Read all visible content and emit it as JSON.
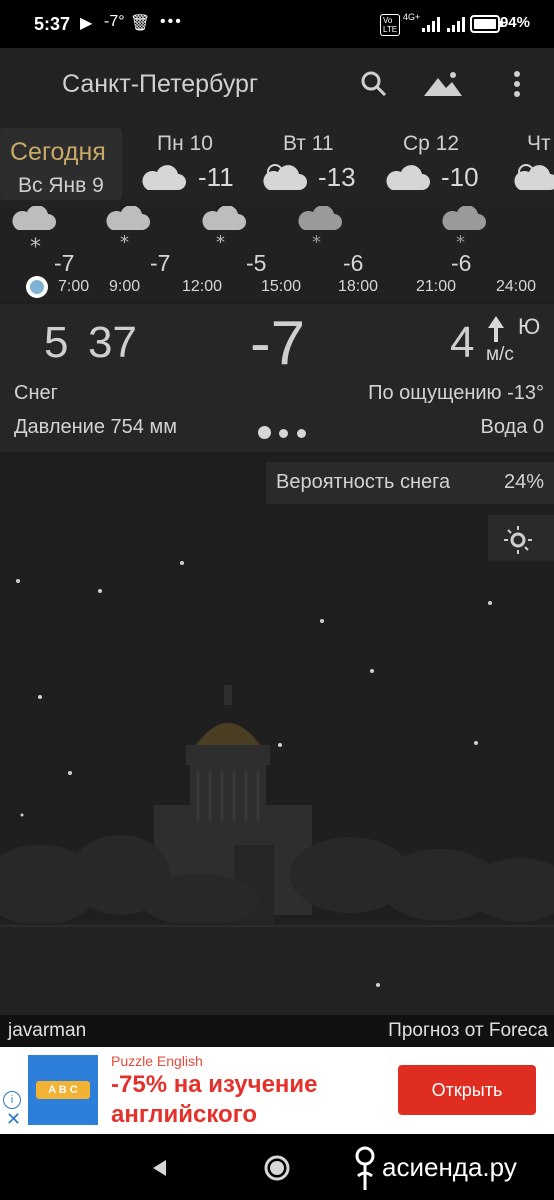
{
  "status": {
    "time": "5:37",
    "temp": "-7°",
    "battery": "94%",
    "net": "4G+",
    "volte": "Vo LTE"
  },
  "header": {
    "city": "Санкт-Петербург"
  },
  "days": {
    "today_label": "Сегодня",
    "today_date": "Вс Янв 9",
    "items": [
      {
        "name": "Пн 10",
        "temp": "-11"
      },
      {
        "name": "Вт 11",
        "temp": "-13"
      },
      {
        "name": "Ср 12",
        "temp": "-10"
      },
      {
        "name": "Чт",
        "temp": ""
      }
    ]
  },
  "hourly": {
    "temps": [
      "-7",
      "-7",
      "-5",
      "-6",
      "-6"
    ],
    "times": [
      "7:00",
      "9:00",
      "12:00",
      "15:00",
      "18:00",
      "21:00",
      "24:00"
    ]
  },
  "current": {
    "hour": "5",
    "minute": "37",
    "temp": "-7",
    "wind_speed": "4",
    "wind_dir": "Ю",
    "wind_unit": "м/с",
    "condition": "Снег",
    "feels_like": "По ощущению -13°",
    "pressure": "Давление 754 мм",
    "water": "Вода 0"
  },
  "probability": {
    "label": "Вероятность снега",
    "value": "24%"
  },
  "footer": {
    "author": "javarman",
    "source": "Прогноз от Foreca"
  },
  "ad": {
    "brand": "Puzzle English",
    "headline_1": "-75% на изучение",
    "headline_2": "английского",
    "cta": "Открыть",
    "logo_text": "A B C",
    "watermark": "асиенда.ру"
  }
}
